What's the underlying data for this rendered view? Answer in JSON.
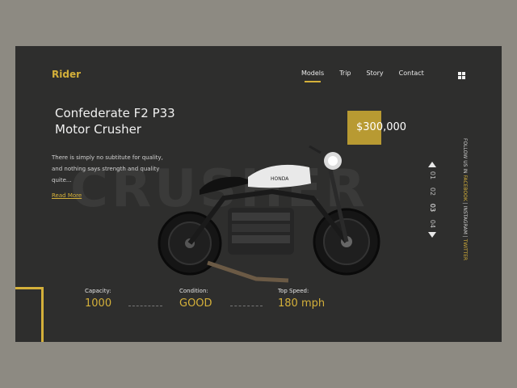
{
  "brand": {
    "name": "Rider"
  },
  "nav": {
    "items": [
      {
        "label": "Models",
        "active": true
      },
      {
        "label": "Trip",
        "active": false
      },
      {
        "label": "Story",
        "active": false
      },
      {
        "label": "Contact",
        "active": false
      }
    ],
    "menu_icon": "grid-icon"
  },
  "hero": {
    "title_line1": "Confederate F2 P33",
    "title_line2": "Motor Crusher",
    "price": "$300,000",
    "description_line1": "There is simply no subtitute for quality,",
    "description_line2": "and nothing says strength and quality",
    "description_line3": "quite...",
    "read_more": "Read More",
    "watermark": "CRUSHER",
    "bike_brand": "HONDA"
  },
  "pager": {
    "up_icon": "chevron-up-icon",
    "down_icon": "chevron-down-icon",
    "pages": [
      "01",
      "02",
      "03",
      "04"
    ],
    "active_index": 2
  },
  "social": {
    "prefix": "FOLLOW US IN",
    "facebook": "FACEBOOK",
    "separator": "|",
    "instagram": "INSTAGRAM",
    "twitter": "TWITTER"
  },
  "stats": [
    {
      "label": "Capacity:",
      "value": "1000"
    },
    {
      "label": "Condition:",
      "value": "GOOD"
    },
    {
      "label": "Top Speed:",
      "value": "180 mph"
    }
  ],
  "colors": {
    "accent": "#d4b03a",
    "card_bg": "#2e2e2d",
    "page_bg": "#8d8a82"
  }
}
